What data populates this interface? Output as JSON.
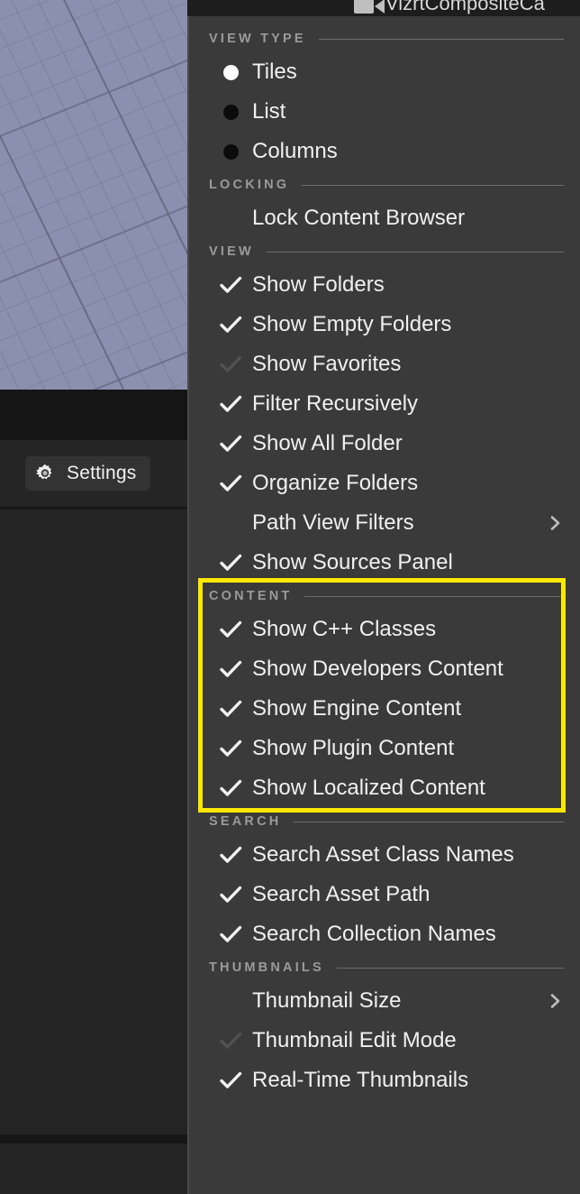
{
  "window": {
    "viewport_title": "VizrtCompositeCa",
    "camera_icon": "camera-icon",
    "settings_button_label": "Settings",
    "gear_icon": "gear-icon"
  },
  "colors": {
    "menu_bg": "#3a3a3a",
    "highlight": "#ffe800",
    "text": "#f0f0f0",
    "section_label": "#9a9a9a",
    "viewport_bg": "#8b8fb0",
    "panel_bg": "#242424"
  },
  "menu": {
    "sections": [
      {
        "label": "VIEW TYPE",
        "items": [
          {
            "label": "Tiles",
            "mark": "radio",
            "checked": true,
            "submenu": false
          },
          {
            "label": "List",
            "mark": "radio",
            "checked": false,
            "submenu": false
          },
          {
            "label": "Columns",
            "mark": "radio",
            "checked": false,
            "submenu": false
          }
        ]
      },
      {
        "label": "LOCKING",
        "items": [
          {
            "label": "Lock Content Browser",
            "mark": "check",
            "checked": false,
            "submenu": false
          }
        ]
      },
      {
        "label": "VIEW",
        "items": [
          {
            "label": "Show Folders",
            "mark": "check",
            "checked": true,
            "submenu": false
          },
          {
            "label": "Show Empty Folders",
            "mark": "check",
            "checked": true,
            "submenu": false
          },
          {
            "label": "Show Favorites",
            "mark": "check",
            "checked": "dim",
            "submenu": false
          },
          {
            "label": "Filter Recursively",
            "mark": "check",
            "checked": true,
            "submenu": false
          },
          {
            "label": "Show All Folder",
            "mark": "check",
            "checked": true,
            "submenu": false
          },
          {
            "label": "Organize Folders",
            "mark": "check",
            "checked": true,
            "submenu": false
          },
          {
            "label": "Path View Filters",
            "mark": "check",
            "checked": false,
            "submenu": true
          },
          {
            "label": "Show Sources Panel",
            "mark": "check",
            "checked": true,
            "submenu": false
          }
        ]
      },
      {
        "label": "CONTENT",
        "highlighted": true,
        "items": [
          {
            "label": "Show C++ Classes",
            "mark": "check",
            "checked": true,
            "submenu": false
          },
          {
            "label": "Show Developers Content",
            "mark": "check",
            "checked": true,
            "submenu": false
          },
          {
            "label": "Show Engine Content",
            "mark": "check",
            "checked": true,
            "submenu": false
          },
          {
            "label": "Show Plugin Content",
            "mark": "check",
            "checked": true,
            "submenu": false
          },
          {
            "label": "Show Localized Content",
            "mark": "check",
            "checked": true,
            "submenu": false
          }
        ]
      },
      {
        "label": "SEARCH",
        "items": [
          {
            "label": "Search Asset Class Names",
            "mark": "check",
            "checked": true,
            "submenu": false
          },
          {
            "label": "Search Asset Path",
            "mark": "check",
            "checked": true,
            "submenu": false
          },
          {
            "label": "Search Collection Names",
            "mark": "check",
            "checked": true,
            "submenu": false
          }
        ]
      },
      {
        "label": "THUMBNAILS",
        "items": [
          {
            "label": "Thumbnail Size",
            "mark": "check",
            "checked": false,
            "submenu": true
          },
          {
            "label": "Thumbnail Edit Mode",
            "mark": "check",
            "checked": "dim",
            "submenu": false
          },
          {
            "label": "Real-Time Thumbnails",
            "mark": "check",
            "checked": true,
            "submenu": false
          }
        ]
      }
    ]
  }
}
